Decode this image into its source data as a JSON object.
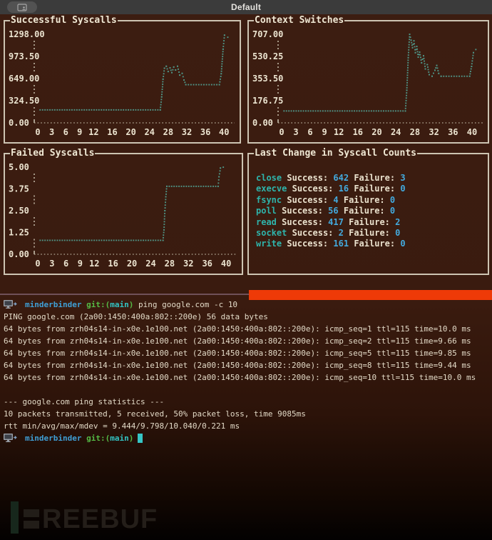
{
  "colors": {
    "chart-dot": "#4f9486",
    "teal": "#2eb4ab",
    "num-blue": "#43aade",
    "orange": "#ee3a07",
    "prompt-blue": "#3f9fd6",
    "prompt-green": "#55bb45",
    "prompt-cyan": "#32c3c3"
  },
  "title_bar": {
    "title": "Default"
  },
  "chart_data": [
    {
      "type": "line",
      "title": "Successful Syscalls",
      "ylim": [
        0,
        1298
      ],
      "xlim": [
        0,
        41.5
      ],
      "yticks": [
        "1298.00",
        "973.50",
        "649.00",
        "324.50",
        "0.00"
      ],
      "xticks": [
        0,
        3,
        6,
        9,
        12,
        16,
        20,
        24,
        28,
        32,
        36,
        40
      ],
      "grid": false,
      "series": [
        {
          "name": "successful_syscalls",
          "points": [
            [
              0.5,
              190
            ],
            [
              26.3,
              190
            ],
            [
              26.6,
              380
            ],
            [
              26.9,
              640
            ],
            [
              27.2,
              800
            ],
            [
              27.6,
              830
            ],
            [
              28.0,
              752
            ],
            [
              28.4,
              806
            ],
            [
              28.8,
              736
            ],
            [
              29.2,
              818
            ],
            [
              29.6,
              775
            ],
            [
              30.0,
              830
            ],
            [
              30.5,
              700
            ],
            [
              31.0,
              725
            ],
            [
              31.4,
              628
            ],
            [
              31.8,
              560
            ],
            [
              39.0,
              560
            ],
            [
              39.4,
              720
            ],
            [
              39.8,
              1080
            ],
            [
              40.1,
              1285
            ],
            [
              40.8,
              1255
            ]
          ]
        }
      ]
    },
    {
      "type": "line",
      "title": "Context Switches",
      "ylim": [
        0,
        707
      ],
      "xlim": [
        0,
        41.5
      ],
      "yticks": [
        "707.00",
        "530.25",
        "353.50",
        "176.75",
        "0.00"
      ],
      "xticks": [
        0,
        3,
        6,
        9,
        12,
        16,
        20,
        24,
        28,
        32,
        36,
        40
      ],
      "grid": false,
      "series": [
        {
          "name": "context_switches",
          "points": [
            [
              0.5,
              95
            ],
            [
              26.0,
              95
            ],
            [
              26.3,
              260
            ],
            [
              26.6,
              520
            ],
            [
              26.9,
              707
            ],
            [
              27.2,
              660
            ],
            [
              27.5,
              600
            ],
            [
              27.8,
              655
            ],
            [
              28.1,
              560
            ],
            [
              28.4,
              610
            ],
            [
              28.7,
              525
            ],
            [
              29.0,
              565
            ],
            [
              29.4,
              480
            ],
            [
              29.8,
              535
            ],
            [
              30.2,
              430
            ],
            [
              30.6,
              465
            ],
            [
              31.0,
              385
            ],
            [
              31.6,
              372
            ],
            [
              32.2,
              420
            ],
            [
              32.6,
              458
            ],
            [
              33.0,
              395
            ],
            [
              33.5,
              372
            ],
            [
              39.5,
              372
            ],
            [
              39.9,
              450
            ],
            [
              40.3,
              560
            ],
            [
              40.8,
              585
            ]
          ]
        }
      ]
    },
    {
      "type": "line",
      "title": "Failed Syscalls",
      "ylim": [
        0,
        5
      ],
      "xlim": [
        0,
        41.5
      ],
      "yticks": [
        "5.00",
        "3.75",
        "2.50",
        "1.25",
        "0.00"
      ],
      "xticks": [
        0,
        3,
        6,
        9,
        12,
        16,
        20,
        24,
        28,
        32,
        36,
        40
      ],
      "grid": false,
      "series": [
        {
          "name": "failed_syscalls",
          "points": [
            [
              0.5,
              0.8
            ],
            [
              26.6,
              0.8
            ],
            [
              26.8,
              1.4
            ],
            [
              27.0,
              2.5
            ],
            [
              27.2,
              3.3
            ],
            [
              27.4,
              3.9
            ],
            [
              38.3,
              3.9
            ],
            [
              38.5,
              4.45
            ],
            [
              38.8,
              4.95
            ],
            [
              39.4,
              5.0
            ]
          ]
        }
      ]
    }
  ],
  "last_change": {
    "title": "Last Change in Syscall Counts",
    "success_label": "Success:",
    "failure_label": "Failure:",
    "rows": [
      {
        "name": "close",
        "success": "642",
        "failure": "3"
      },
      {
        "name": "execve",
        "success": "16",
        "failure": "0"
      },
      {
        "name": "fsync",
        "success": "4",
        "failure": "0"
      },
      {
        "name": "poll",
        "success": "56",
        "failure": "0"
      },
      {
        "name": "read",
        "success": "417",
        "failure": "2"
      },
      {
        "name": "socket",
        "success": "2",
        "failure": "0"
      },
      {
        "name": "write",
        "success": "161",
        "failure": "0"
      }
    ]
  },
  "terminal": {
    "prompt": {
      "host": "minderbinder",
      "git_prefix": "git:(",
      "branch": "main",
      "git_suffix": ")",
      "command": "ping google.com -c 10"
    },
    "output": [
      "PING google.com (2a00:1450:400a:802::200e) 56 data bytes",
      "64 bytes from zrh04s14-in-x0e.1e100.net (2a00:1450:400a:802::200e): icmp_seq=1 ttl=115 time=10.0 ms",
      "64 bytes from zrh04s14-in-x0e.1e100.net (2a00:1450:400a:802::200e): icmp_seq=2 ttl=115 time=9.66 ms",
      "64 bytes from zrh04s14-in-x0e.1e100.net (2a00:1450:400a:802::200e): icmp_seq=5 ttl=115 time=9.85 ms",
      "64 bytes from zrh04s14-in-x0e.1e100.net (2a00:1450:400a:802::200e): icmp_seq=8 ttl=115 time=9.44 ms",
      "64 bytes from zrh04s14-in-x0e.1e100.net (2a00:1450:400a:802::200e): icmp_seq=10 ttl=115 time=10.0 ms",
      "",
      "--- google.com ping statistics ---",
      "10 packets transmitted, 5 received, 50% packet loss, time 9085ms",
      "rtt min/avg/max/mdev = 9.444/9.798/10.040/0.221 ms"
    ]
  },
  "watermark": {
    "text": "REEBUF"
  }
}
